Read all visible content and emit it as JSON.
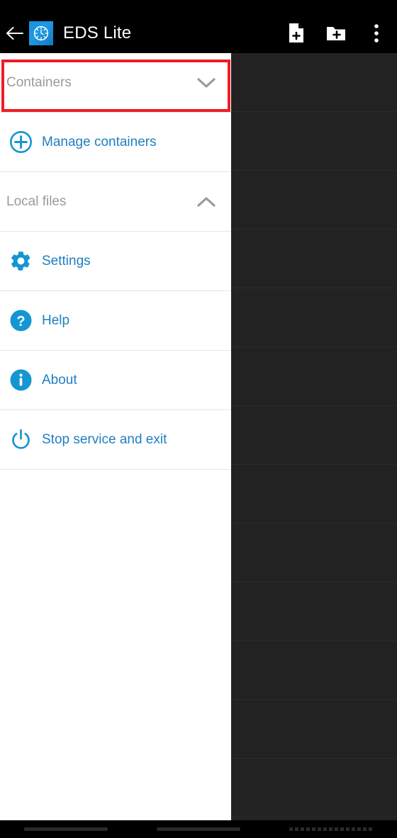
{
  "appbar": {
    "back_icon": "arrow-back-icon",
    "app_icon": "eds-app-icon",
    "title": "EDS Lite",
    "actions": [
      {
        "name": "new-file-button",
        "icon": "file-plus-icon"
      },
      {
        "name": "new-folder-button",
        "icon": "folder-plus-icon"
      },
      {
        "name": "overflow-menu-button",
        "icon": "more-vert-icon"
      }
    ]
  },
  "drawer": {
    "sections": [
      {
        "id": "containers",
        "label": "Containers",
        "chevron": "chevron-down-icon",
        "expanded": false,
        "highlighted": true
      },
      {
        "id": "local-files",
        "label": "Local files",
        "chevron": "chevron-up-icon",
        "expanded": true,
        "highlighted": false
      }
    ],
    "manage_containers": {
      "label": "Manage containers",
      "icon": "plus-circle-icon"
    },
    "menu": [
      {
        "id": "settings",
        "label": "Settings",
        "icon": "gear-icon"
      },
      {
        "id": "help",
        "label": "Help",
        "icon": "help-circle-icon"
      },
      {
        "id": "about",
        "label": "About",
        "icon": "info-circle-icon"
      },
      {
        "id": "stop-service",
        "label": "Stop service and exit",
        "icon": "power-icon"
      }
    ]
  },
  "navbar": {
    "items": [
      {
        "name": "nav-back-button"
      },
      {
        "name": "nav-home-button"
      },
      {
        "name": "nav-recents-button"
      }
    ]
  },
  "colors": {
    "accent_blue": "#1f7fc0",
    "icon_blue": "#1496d3",
    "highlight_red": "#ee1c25",
    "appbar_bg": "#000000",
    "drawer_bg": "#ffffff",
    "scrim_bg": "#222222",
    "section_label": "#9a9a9a"
  }
}
